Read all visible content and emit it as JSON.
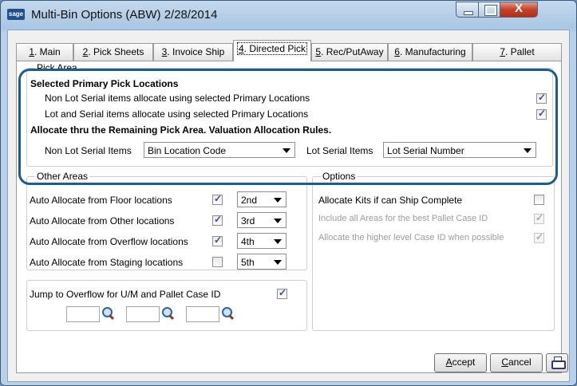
{
  "window": {
    "logo_text": "sage",
    "title": "Multi-Bin Options (ABW) 2/28/2014",
    "close_symbol": "X"
  },
  "tabs": [
    {
      "key": "1",
      "label": ". Main"
    },
    {
      "key": "2",
      "label": ". Pick Sheets"
    },
    {
      "key": "3",
      "label": ". Invoice Ship"
    },
    {
      "key": "4",
      "label": ". Directed Pick"
    },
    {
      "key": "5",
      "label": ". Rec/PutAway"
    },
    {
      "key": "6",
      "label": ". Manufacturing"
    },
    {
      "key": "7",
      "label": ". Pallet"
    }
  ],
  "active_tab": "4. Directed Pick",
  "pick_area": {
    "title": "Pick Area",
    "selected_header": "Selected Primary Pick Locations",
    "non_lot_label": "Non Lot Serial items allocate using selected Primary Locations",
    "non_lot_checked": true,
    "lot_label": "Lot and Serial items allocate using selected Primary Locations",
    "lot_checked": true,
    "allocate_header": "Allocate thru the Remaining Pick Area.  Valuation Allocation Rules.",
    "non_lot_items_label": "Non Lot Serial Items",
    "non_lot_items_value": "Bin Location Code",
    "lot_items_label": "Lot Serial Items",
    "lot_items_value": "Lot Serial Number"
  },
  "other_areas": {
    "title": "Other Areas",
    "rows": [
      {
        "label": "Auto Allocate from Floor locations",
        "checked": true,
        "order": "2nd"
      },
      {
        "label": "Auto Allocate from Other locations",
        "checked": true,
        "order": "3rd"
      },
      {
        "label": "Auto Allocate from Overflow locations",
        "checked": true,
        "order": "4th"
      },
      {
        "label": "Auto Allocate from Staging locations",
        "checked": false,
        "order": "5th"
      }
    ]
  },
  "overflow": {
    "label": "Jump to Overflow for U/M and Pallet Case ID",
    "checked": true,
    "input1": "",
    "input2": "",
    "input3": ""
  },
  "options": {
    "title": "Options",
    "kits_label": "Allocate Kits if can Ship Complete",
    "kits_checked": false,
    "include_label": "Include all Areas for the best Pallet Case ID",
    "include_checked": true,
    "higher_label": "Allocate the higher level Case ID when possible",
    "higher_checked": true
  },
  "buttons": {
    "accept_key": "A",
    "accept_rest": "ccept",
    "cancel_key": "C",
    "cancel_rest": "ancel"
  },
  "icons": {
    "lookup": "magnifier-icon",
    "print": "printer-icon"
  },
  "colors": {
    "highlight": "#1b5e87",
    "close_button": "#c4422a",
    "title_bar": "#a9c6e3"
  }
}
